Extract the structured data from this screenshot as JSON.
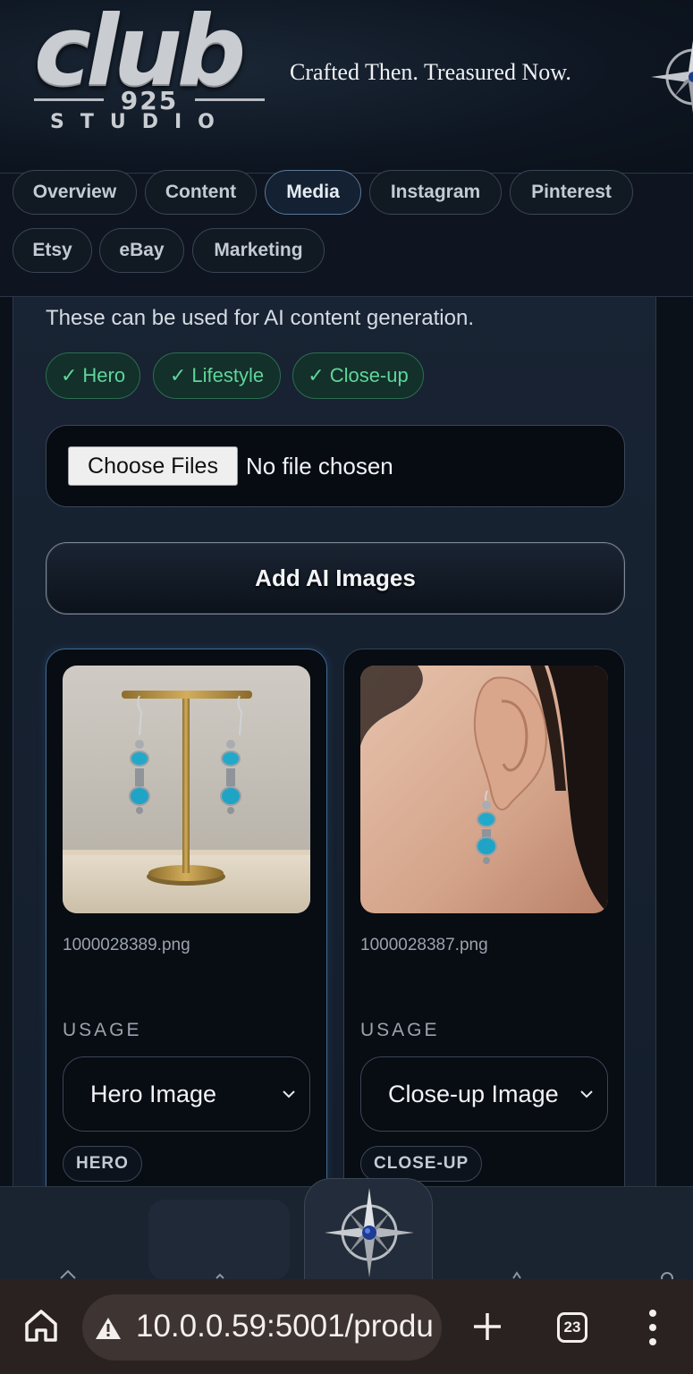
{
  "header": {
    "logo": {
      "word": "club",
      "number": "925",
      "sub": "STUDIO"
    },
    "tagline": "Crafted Then. Treasured Now.",
    "compass_icon": "compass-rose-icon"
  },
  "tabs": [
    {
      "label": "Overview",
      "active": false
    },
    {
      "label": "Content",
      "active": false
    },
    {
      "label": "Media",
      "active": true
    },
    {
      "label": "Instagram",
      "active": false
    },
    {
      "label": "Pinterest",
      "active": false
    },
    {
      "label": "Etsy",
      "active": false
    },
    {
      "label": "eBay",
      "active": false
    },
    {
      "label": "Marketing",
      "active": false
    }
  ],
  "media": {
    "note": "These can be used for AI content generation.",
    "chips": [
      {
        "check": "✓",
        "label": "Hero"
      },
      {
        "check": "✓",
        "label": "Lifestyle"
      },
      {
        "check": "✓",
        "label": "Close-up"
      }
    ],
    "file_input": {
      "button": "Choose Files",
      "status": "No file chosen"
    },
    "add_button": "Add AI Images",
    "images": [
      {
        "filename": "1000028389.png",
        "usage_label": "USAGE",
        "usage_value": "Hero Image",
        "badge": "HERO",
        "scene": "earrings-on-brass-stand"
      },
      {
        "filename": "1000028387.png",
        "usage_label": "USAGE",
        "usage_value": "Close-up Image",
        "badge": "CLOSE-UP",
        "scene": "earring-worn-on-ear"
      }
    ]
  },
  "bottom_nav": {
    "center_icon": "compass-rose-icon"
  },
  "browser": {
    "url": "10.0.0.59:5001/produ",
    "tab_count": "23",
    "icons": [
      "home-icon",
      "warning-icon",
      "plus-icon",
      "tab-switcher-icon",
      "more-vert-icon"
    ]
  },
  "colors": {
    "accent_green": "#5fd59a",
    "active_tab_border": "#5a7898",
    "background": "#0b1119"
  }
}
